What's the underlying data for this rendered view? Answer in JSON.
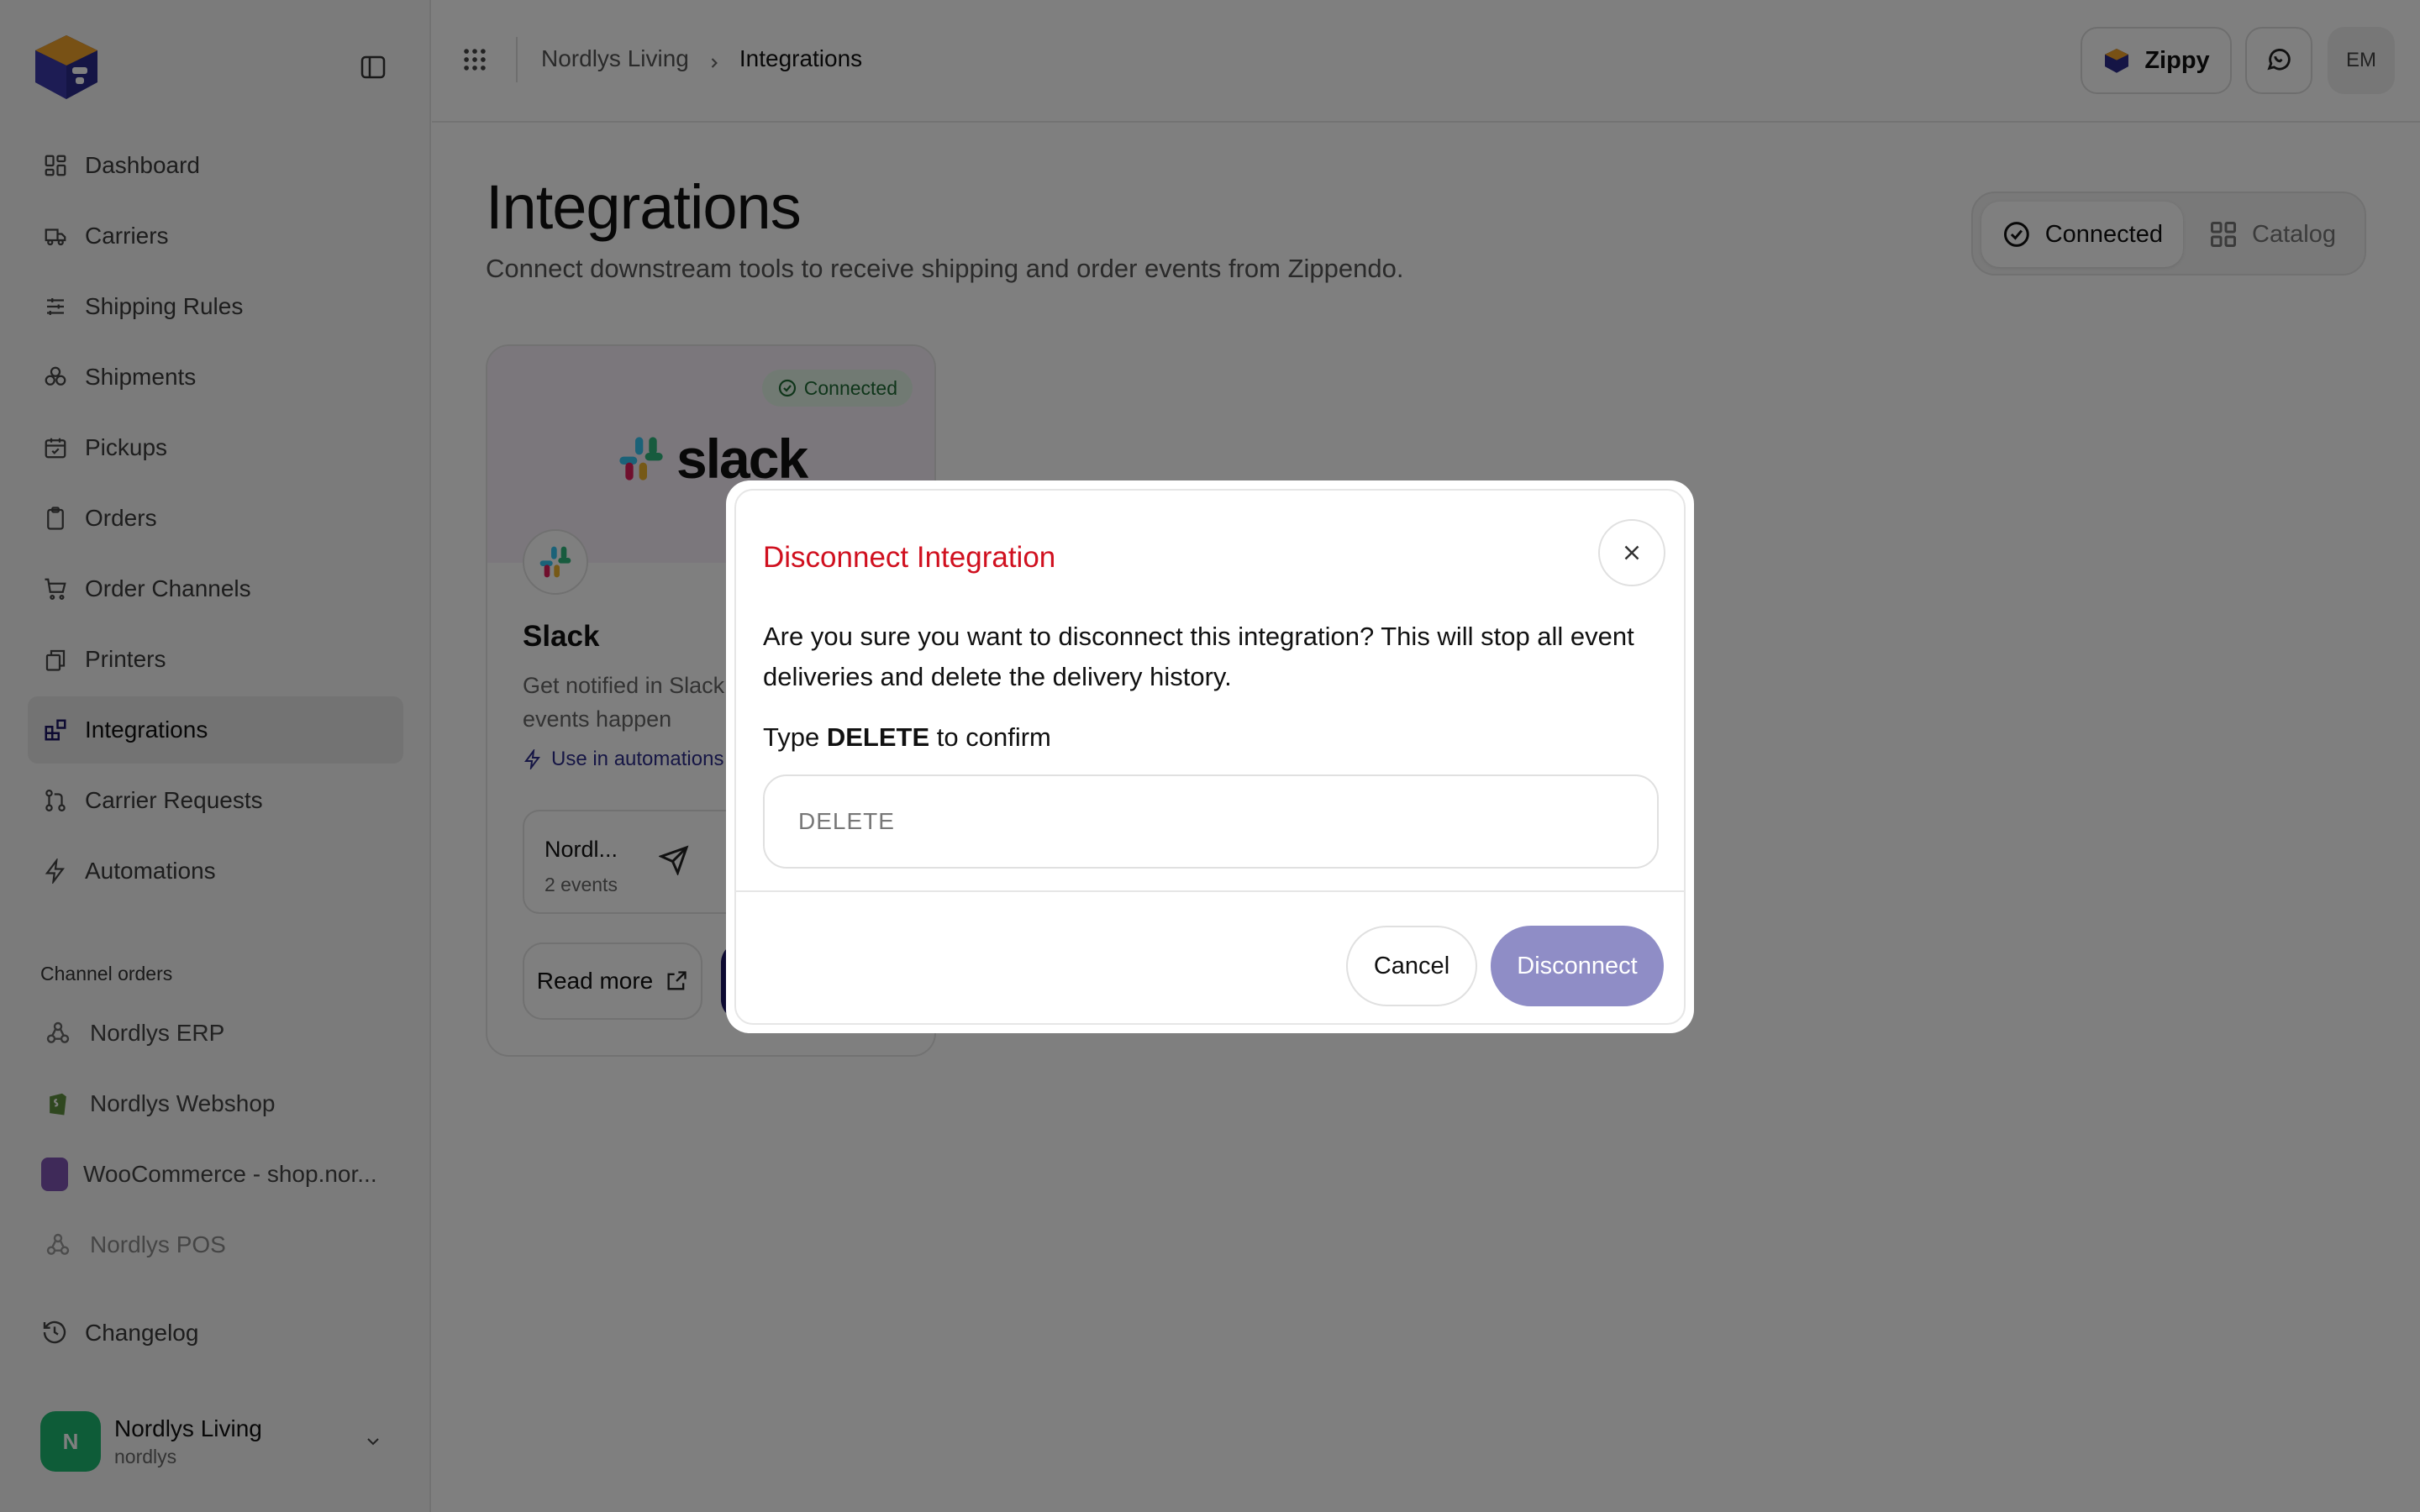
{
  "sidebar": {
    "nav": [
      {
        "label": "Dashboard",
        "icon": "layout-dashboard-icon"
      },
      {
        "label": "Carriers",
        "icon": "truck-icon"
      },
      {
        "label": "Shipping Rules",
        "icon": "sliders-icon"
      },
      {
        "label": "Shipments",
        "icon": "boxes-icon"
      },
      {
        "label": "Pickups",
        "icon": "calendar-check-icon"
      },
      {
        "label": "Orders",
        "icon": "clipboard-icon"
      },
      {
        "label": "Order Channels",
        "icon": "cart-icon"
      },
      {
        "label": "Printers",
        "icon": "printer-icon"
      },
      {
        "label": "Integrations",
        "icon": "blocks-icon",
        "active": true
      },
      {
        "label": "Carrier Requests",
        "icon": "git-pull-request-icon"
      },
      {
        "label": "Automations",
        "icon": "zap-icon"
      }
    ],
    "section_label": "Channel orders",
    "channels": [
      {
        "label": "Nordlys ERP",
        "icon": "webhook-icon"
      },
      {
        "label": "Nordlys Webshop",
        "icon": "shopify-icon"
      },
      {
        "label": "WooCommerce - shop.nor...",
        "icon": "woocommerce-icon"
      },
      {
        "label": "Nordlys POS",
        "icon": "webhook-icon",
        "dim": true
      }
    ],
    "changelog": "Changelog",
    "account": {
      "initial": "N",
      "name": "Nordlys Living",
      "slug": "nordlys"
    }
  },
  "topbar": {
    "breadcrumb": [
      "Nordlys Living",
      "Integrations"
    ],
    "zippy": "Zippy",
    "user_initials": "EM"
  },
  "main": {
    "title": "Integrations",
    "subtitle": "Connect downstream tools to receive shipping and order events from Zippendo.",
    "toggle": {
      "connected": "Connected",
      "catalog": "Catalog"
    }
  },
  "card": {
    "badge": "Connected",
    "logo_text": "slack",
    "name": "Slack",
    "description": "Get notified in Slack when shipping events happen",
    "automations": "Use in automations",
    "channel_name": "Nordl...",
    "channel_events": "2 events",
    "read_more": "Read more"
  },
  "modal": {
    "title": "Disconnect Integration",
    "message": "Are you sure you want to disconnect this integration? This will stop all event deliveries and delete the delivery history.",
    "prompt_prefix": "Type",
    "prompt_keyword": "DELETE",
    "prompt_suffix": "to confirm",
    "input_placeholder": "DELETE",
    "input_value": "",
    "cancel": "Cancel",
    "confirm": "Disconnect"
  },
  "colors": {
    "danger": "#d0101f",
    "brand_dark": "#1b1464",
    "confirm_disabled": "#8f8dc6",
    "success_badge": "#e3f5e6",
    "avatar_green": "#1db870"
  }
}
